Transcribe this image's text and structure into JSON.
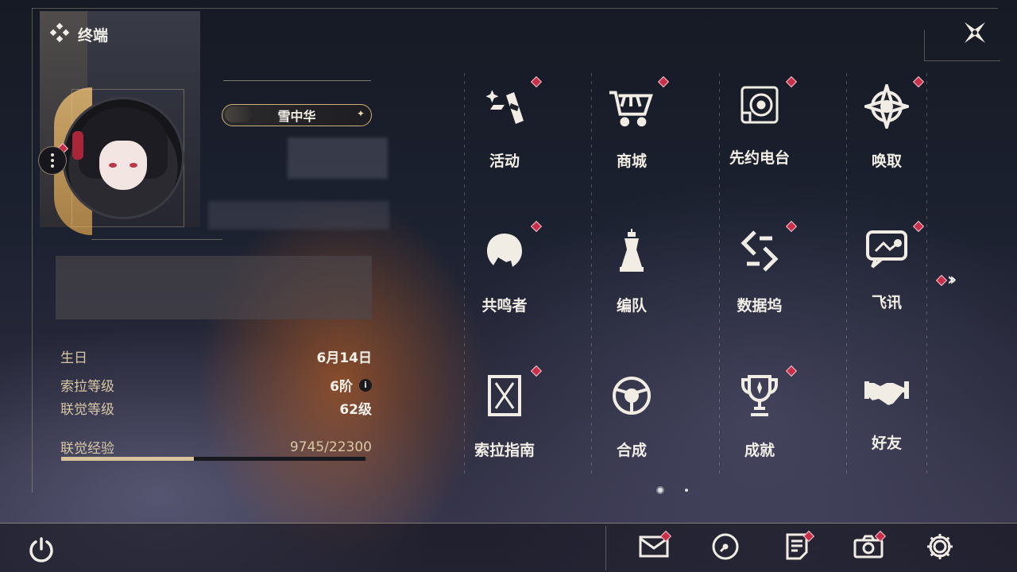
{
  "header": {
    "title": "终端"
  },
  "profile": {
    "name": "雪中华"
  },
  "stats": {
    "birthday_label": "生日",
    "birthday_value": "6月14日",
    "sola_level_label": "索拉等级",
    "sola_level_value": "6阶",
    "union_level_label": "联觉等级",
    "union_level_value": "62级",
    "exp_label": "联觉经验",
    "exp_value": "9745/22300",
    "exp_fraction": 0.437
  },
  "grid": [
    {
      "label": "活动",
      "icon": "activity-icon",
      "badge": true
    },
    {
      "label": "商城",
      "icon": "shop-cart-icon",
      "badge": true
    },
    {
      "label": "先约电台",
      "icon": "radio-icon",
      "badge": true
    },
    {
      "label": "唤取",
      "icon": "summon-compass-icon",
      "badge": true
    },
    {
      "label": "共鸣者",
      "icon": "resonator-head-icon",
      "badge": true
    },
    {
      "label": "编队",
      "icon": "chess-team-icon",
      "badge": false
    },
    {
      "label": "数据坞",
      "icon": "data-dock-icon",
      "badge": true
    },
    {
      "label": "飞讯",
      "icon": "message-bubble-icon",
      "badge": true
    },
    {
      "label": "索拉指南",
      "icon": "guide-book-icon",
      "badge": true
    },
    {
      "label": "合成",
      "icon": "synthesis-icon",
      "badge": false
    },
    {
      "label": "成就",
      "icon": "trophy-icon",
      "badge": true
    },
    {
      "label": "好友",
      "icon": "handshake-icon",
      "badge": false
    }
  ],
  "pagination": {
    "current": 1,
    "total": 2
  },
  "bottom_bar": [
    "mail-icon",
    "clock-icon",
    "notes-icon",
    "camera-icon",
    "gear-icon"
  ],
  "colors": {
    "accent": "#d9c39b",
    "badge": "#c8304a",
    "text": "#f3efe6",
    "label": "#d8c7a4"
  }
}
